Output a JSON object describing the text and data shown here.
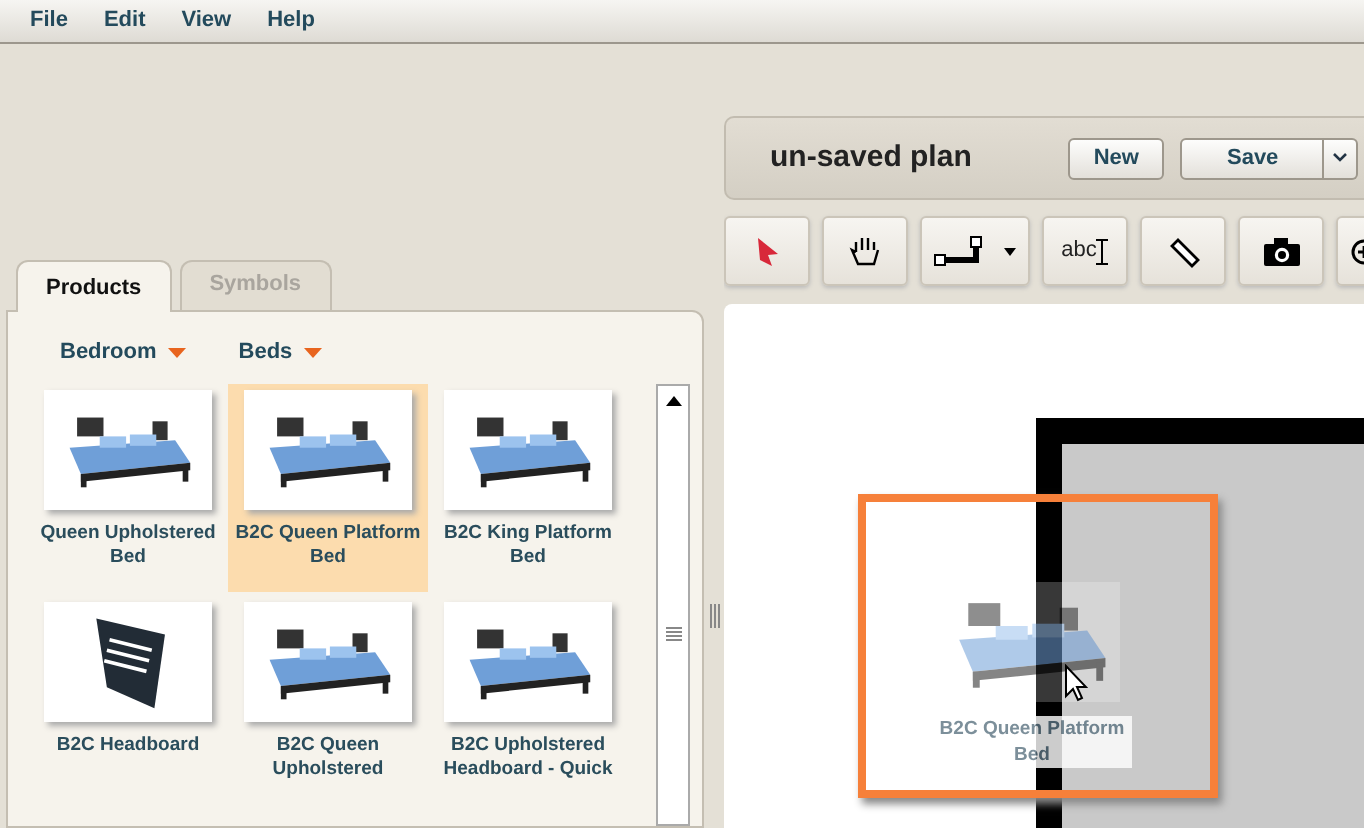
{
  "menu": [
    "File",
    "Edit",
    "View",
    "Help"
  ],
  "plan": {
    "title": "un-saved plan",
    "buttons": [
      {
        "label": "New",
        "kind": "plain"
      },
      {
        "label": "Save",
        "kind": "split"
      }
    ]
  },
  "tools": [
    {
      "kind": "pointer"
    },
    {
      "kind": "hand"
    },
    {
      "kind": "wall"
    },
    {
      "kind": "text",
      "label": "abc"
    },
    {
      "kind": "ruler"
    },
    {
      "kind": "camera"
    },
    {
      "kind": "zoom"
    }
  ],
  "tabs": [
    {
      "label": "Products",
      "selected": true
    },
    {
      "label": "Symbols",
      "selected": false
    }
  ],
  "filters": [
    "Bedroom",
    "Beds"
  ],
  "products": [
    {
      "name": "Queen Upholstered Bed",
      "kind": "bed",
      "selected": false
    },
    {
      "name": "B2C Queen Platform Bed",
      "kind": "bed",
      "selected": true
    },
    {
      "name": "B2C King Platform Bed",
      "kind": "bed",
      "selected": false
    },
    {
      "name": "B2C Headboard",
      "kind": "headboard",
      "selected": false
    },
    {
      "name": "B2C Queen Upholstered",
      "kind": "bed",
      "selected": false
    },
    {
      "name": "B2C Upholstered Headboard - Quick",
      "kind": "bed",
      "selected": false
    }
  ],
  "drag_item": {
    "name": "B2C Queen Platform Bed",
    "kind": "bed"
  }
}
